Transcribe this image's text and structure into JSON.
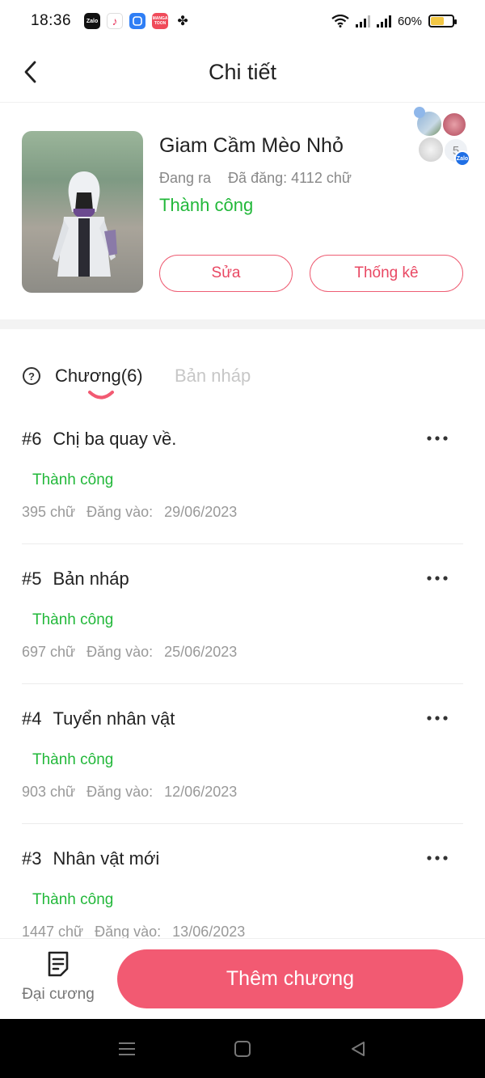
{
  "status_bar": {
    "time": "18:36",
    "battery": "60%",
    "battery_level": 0.6,
    "apps": [
      {
        "icon": "zalo-icon",
        "label": "Zalo",
        "color": "#111111"
      },
      {
        "icon": "tiktok-icon",
        "label": "",
        "color": "#ffffff"
      },
      {
        "icon": "messenger-icon",
        "label": "",
        "color": "#2f7ef5"
      },
      {
        "icon": "manga-toon-icon",
        "label": "MANGA TOON",
        "color": "#f04b5a"
      },
      {
        "icon": "maple-leaf-icon",
        "label": "",
        "color": "#111111"
      }
    ]
  },
  "header": {
    "title": "Chi tiết",
    "back_icon": "chevron-left-icon"
  },
  "book": {
    "title": "Giam Cầm Mèo Nhỏ",
    "state": "Đang ra",
    "posted": "Đã đăng: 4112 chữ",
    "status": "Thành công",
    "edit_label": "Sửa",
    "stats_label": "Thống kê",
    "avatar_badge": "5",
    "avatar_brand": "Zalo"
  },
  "tabs": {
    "chapters": "Chương(6)",
    "drafts": "Bản nháp",
    "help_icon": "question-circle-icon"
  },
  "chapters": [
    {
      "number": "#6",
      "title": "Chị ba quay về.",
      "status": "Thành công",
      "words": "395 chữ",
      "date_label": "Đăng vào:",
      "date": "29/06/2023"
    },
    {
      "number": "#5",
      "title": "Bản nháp",
      "status": "Thành công",
      "words": "697 chữ",
      "date_label": "Đăng vào:",
      "date": "25/06/2023"
    },
    {
      "number": "#4",
      "title": "Tuyển nhân vật",
      "status": "Thành công",
      "words": "903 chữ",
      "date_label": "Đăng vào:",
      "date": "12/06/2023"
    },
    {
      "number": "#3",
      "title": "Nhân vật mới",
      "status": "Thành công",
      "words": "1447 chữ",
      "date_label": "Đăng vào:",
      "date": "13/06/2023"
    }
  ],
  "bottom": {
    "outline_label": "Đại cương",
    "add_label": "Thêm chương"
  },
  "colors": {
    "accent": "#f25a72",
    "success": "#22b83a"
  }
}
